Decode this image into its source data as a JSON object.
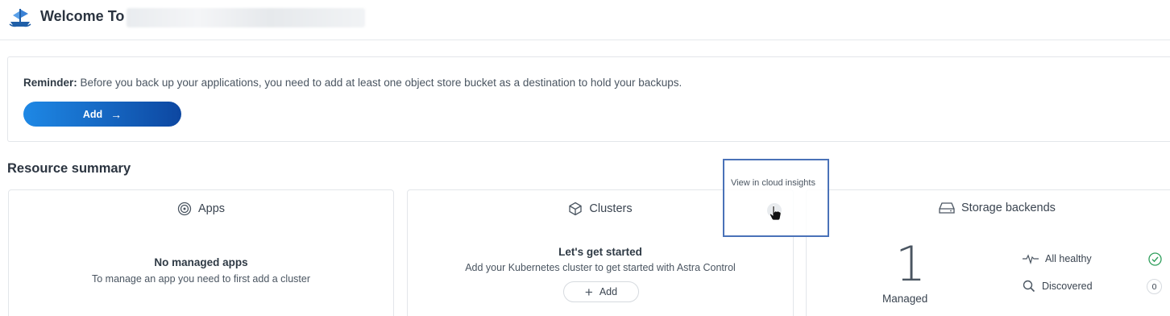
{
  "header": {
    "welcome_label": "Welcome To",
    "logo_icon": "astra-ship-icon"
  },
  "reminder": {
    "label": "Reminder:",
    "text": " Before you back up your applications, you need to add at least one object store bucket as a destination to hold your backups.",
    "button_label": "Add",
    "button_icon": "arrow-right-icon"
  },
  "resource_summary": {
    "title": "Resource summary",
    "apps": {
      "title": "Apps",
      "icon": "apps-icon",
      "empty_title": "No managed apps",
      "empty_text": "To manage an app you need to first add a cluster"
    },
    "clusters": {
      "title": "Clusters",
      "icon": "cube-icon",
      "empty_title": "Let's get started",
      "empty_text": "Add your Kubernetes cluster to get started with Astra Control",
      "add_label": "Add"
    },
    "storage": {
      "title": "Storage backends",
      "icon": "drive-icon",
      "count": "1",
      "count_label": "Managed",
      "healthy_label": "All healthy",
      "discovered_label": "Discovered",
      "discovered_count": "0"
    }
  },
  "tooltip": {
    "text": "View in cloud insights"
  },
  "colors": {
    "accent": "#1565c0",
    "highlight_border": "#4a72b8",
    "healthy": "#2e9e5b"
  }
}
